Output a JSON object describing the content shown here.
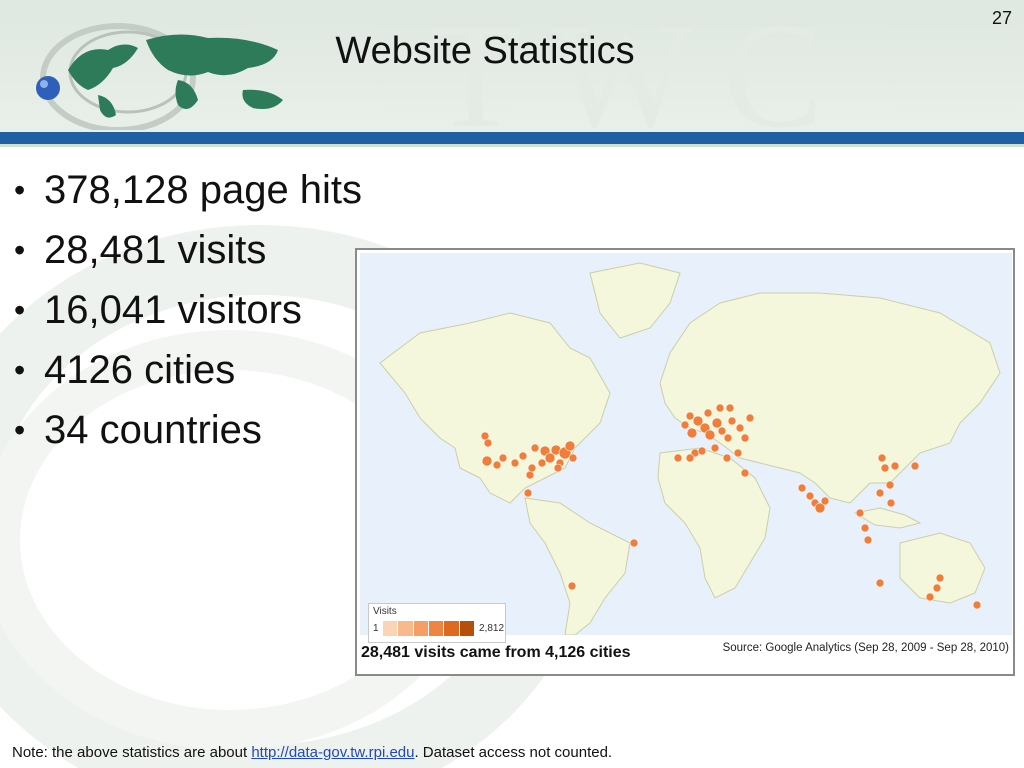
{
  "slide": {
    "page_number": "27",
    "title": "Website Statistics",
    "watermark_text": "TWC"
  },
  "bullets": [
    "378,128 page hits",
    "28,481 visits",
    "16,041 visitors",
    "4126 cities",
    "34 countries"
  ],
  "map": {
    "caption": "28,481 visits came from 4,126 cities",
    "source": "Source: Google Analytics (Sep 28, 2009 - Sep 28, 2010)",
    "legend": {
      "title": "Visits",
      "min": "1",
      "max": "2,812"
    },
    "colors": {
      "ocean": "#e8f1fb",
      "land": "#f5f7dc",
      "marker": "#f07d3a"
    },
    "regions": [
      "united-states-markers",
      "europe-markers",
      "south-asia-markers",
      "east-asia-markers",
      "australia-markers",
      "south-america-markers"
    ]
  },
  "note": {
    "prefix": "Note: the above statistics are about ",
    "link": "http://data-gov.tw.rpi.edu",
    "suffix": ".  Dataset access not counted."
  },
  "colors": {
    "header_band": "#1f5fa4",
    "link": "#1f47c8"
  },
  "icons": [
    "globe-logo-icon"
  ]
}
